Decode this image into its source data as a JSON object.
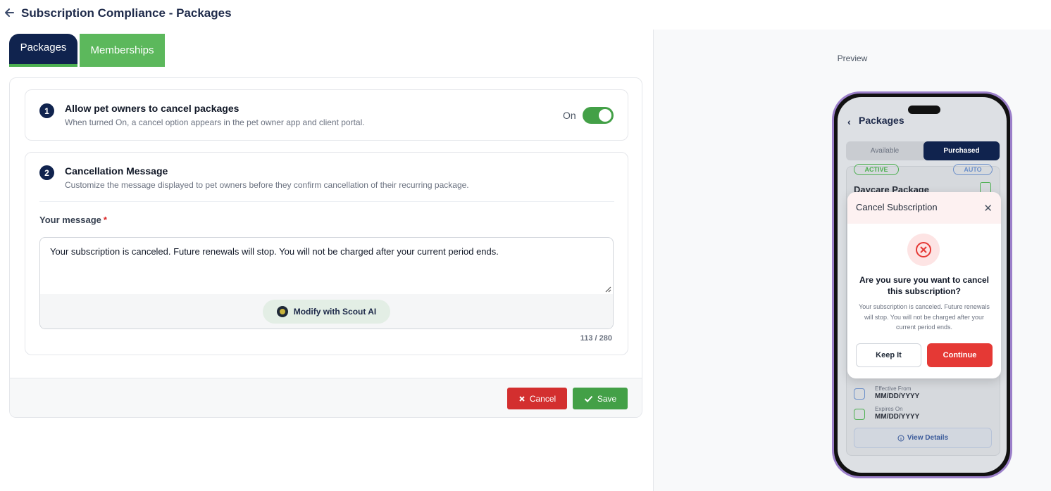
{
  "header": {
    "title": "Subscription Compliance - Packages"
  },
  "tabs": [
    {
      "label": "Packages",
      "active": true
    },
    {
      "label": "Memberships",
      "active": false
    }
  ],
  "section1": {
    "step": "1",
    "title": "Allow pet owners to cancel packages",
    "description": "When turned On, a cancel option appears in the pet owner app and client portal.",
    "toggle_label": "On",
    "toggle_state": true
  },
  "section2": {
    "step": "2",
    "title": "Cancellation Message",
    "description": "Customize the message displayed to pet owners before they confirm cancellation of their recurring package.",
    "field_label": "Your message",
    "required_mark": "*",
    "message_value": "Your subscription is canceled. Future renewals will stop. You will not be charged after your current period ends.",
    "ai_button_label": "Modify with Scout AI",
    "char_count": "113 / 280"
  },
  "footer": {
    "cancel_label": "Cancel",
    "save_label": "Save"
  },
  "preview": {
    "label": "Preview",
    "app_title": "Packages",
    "back_glyph": "‹",
    "segments": {
      "available": "Available",
      "purchased": "Purchased"
    },
    "background_card": {
      "badge_active": "ACTIVE",
      "badge_auto": "AUTO",
      "package_title": "Daycare Package",
      "effective_label": "Effective From",
      "effective_value": "MM/DD/YYYY",
      "expires_label": "Expires On",
      "expires_value": "MM/DD/YYYY",
      "view_details": "View Details"
    },
    "modal": {
      "title": "Cancel Subscription",
      "close_glyph": "✕",
      "question": "Are you sure you want to cancel this subscription?",
      "message": "Your subscription is canceled. Future renewals will stop. You will not be charged after your current period ends.",
      "keep_label": "Keep It",
      "continue_label": "Continue"
    }
  },
  "colors": {
    "navy": "#10234e",
    "green": "#43a047",
    "tab_green": "#5cb85c",
    "red": "#d32f2f",
    "continue_red": "#e53935",
    "phone_border": "#9b7fc9"
  }
}
